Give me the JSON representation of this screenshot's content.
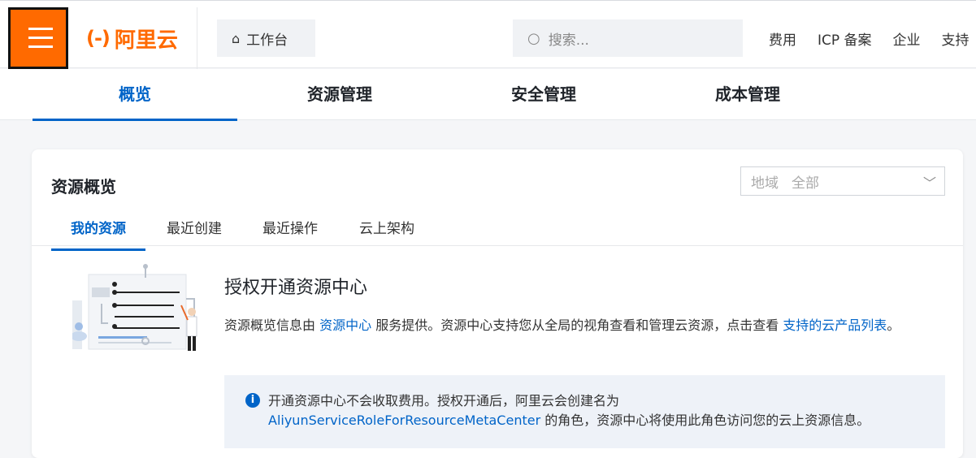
{
  "topbar": {
    "logo_mark": "(-)",
    "logo_text": "阿里云",
    "workbench_label": "工作台",
    "search_placeholder": "搜索...",
    "links": [
      "费用",
      "ICP 备案",
      "企业",
      "支持"
    ]
  },
  "main_tabs": [
    "概览",
    "资源管理",
    "安全管理",
    "成本管理"
  ],
  "card": {
    "title": "资源概览",
    "region_label": "地域",
    "region_value": "全部",
    "subtabs": [
      "我的资源",
      "最近创建",
      "最近操作",
      "云上架构"
    ],
    "auth_title": "授权开通资源中心",
    "desc_pre": "资源概览信息由 ",
    "desc_link1": "资源中心",
    "desc_mid": " 服务提供。资源中心支持您从全局的视角查看和管理云资源，点击查看 ",
    "desc_link2": "支持的云产品列表",
    "desc_end": "。",
    "notice_line1": "开通资源中心不会收取费用。授权开通后，阿里云会创建名为",
    "notice_role": "AliyunServiceRoleForResourceMetaCenter",
    "notice_line2": " 的角色，资源中心将使用此角色访问您的云上资源信息。"
  },
  "colors": {
    "brand": "#ff6a00",
    "accent": "#0064c8"
  }
}
